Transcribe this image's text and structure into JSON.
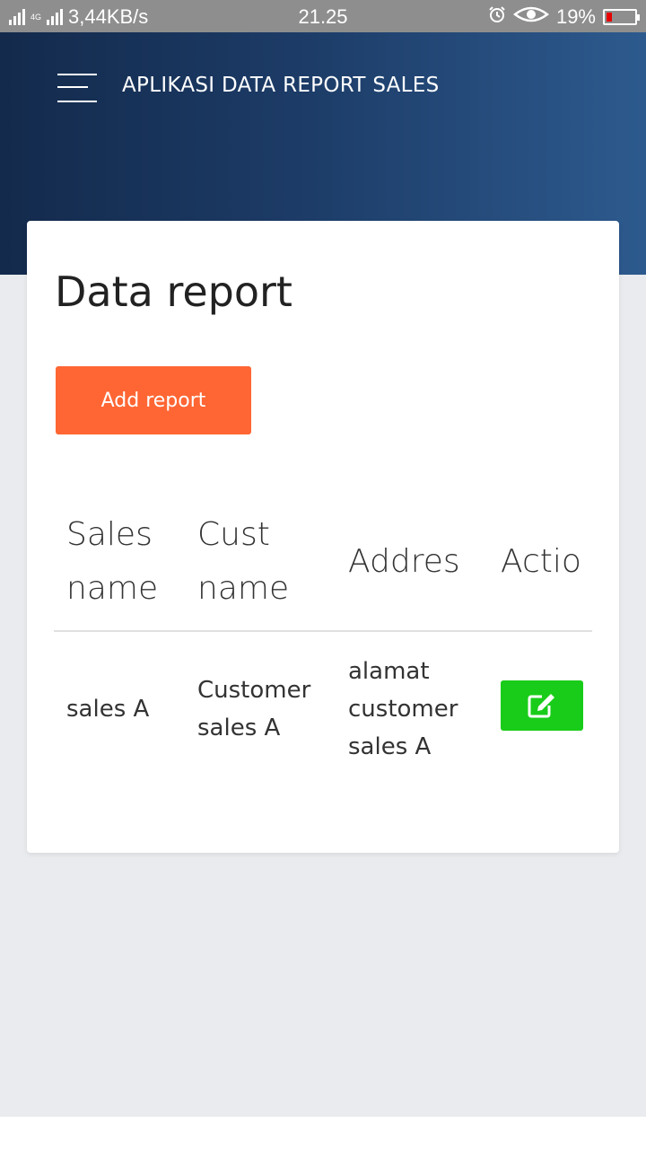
{
  "status_bar": {
    "network_speed": "3,44KB/s",
    "network_type": "4G",
    "time": "21.25",
    "battery_percent": "19%",
    "battery_level": 0.19
  },
  "header": {
    "title": "APLIKASI DATA REPORT SALES",
    "menu_icon": "hamburger-menu-icon"
  },
  "card": {
    "title": "Data report",
    "add_button_label": "Add report",
    "table": {
      "columns": [
        [
          "Sales",
          "name"
        ],
        [
          "Cust",
          "name"
        ],
        [
          "Addres"
        ],
        [
          "Actio"
        ]
      ],
      "rows": [
        {
          "sales_name": [
            "sales A"
          ],
          "cust_name": [
            "Customer",
            "sales A"
          ],
          "address": [
            "alamat",
            "customer",
            "sales A"
          ],
          "action_icon": "edit-icon"
        }
      ]
    }
  },
  "colors": {
    "header_gradient_start": "#132a4c",
    "header_gradient_end": "#2d5a8e",
    "add_button": "#ff6633",
    "edit_button": "#19cc19",
    "background": "#e9ebee"
  }
}
